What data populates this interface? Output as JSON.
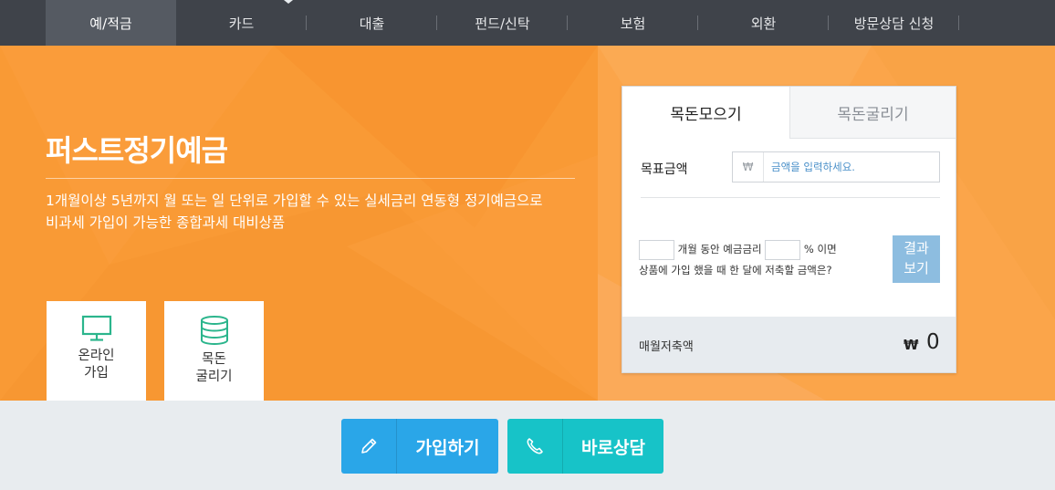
{
  "nav": {
    "items": [
      {
        "label": "예/적금",
        "active": true
      },
      {
        "label": "카드",
        "active": false
      },
      {
        "label": "대출",
        "active": false
      },
      {
        "label": "펀드/신탁",
        "active": false
      },
      {
        "label": "보험",
        "active": false
      },
      {
        "label": "외환",
        "active": false
      },
      {
        "label": "방문상담 신청",
        "active": false
      }
    ]
  },
  "hero": {
    "title": "퍼스트정기예금",
    "description_line1": "1개월이상 5년까지 월 또는 일 단위로 가입할 수 있는 실세금리 연동형 정기예금으로",
    "description_line2": "비과세 가입이 가능한 종합과세 대비상품",
    "tiles": [
      {
        "label": "온라인\n가입",
        "icon": "monitor-icon"
      },
      {
        "label": "목돈\n굴리기",
        "icon": "database-icon"
      }
    ]
  },
  "calculator": {
    "tab_active": "목돈모으기",
    "tab_inactive": "목돈굴리기",
    "amount_label": "목표금액",
    "currency_symbol": "₩",
    "amount_placeholder": "금액을 입력하세요.",
    "amount_value": "",
    "months_value": "",
    "rate_value": "",
    "sentence_part1": "개월 동안 예금금리",
    "sentence_part2": "% 이면",
    "sentence_part3": "상품에 가입 했을 때 한 달에 저축할 금액은?",
    "result_button": "결과\n보기",
    "monthly_label": "매월저축액",
    "monthly_currency": "₩",
    "monthly_value": "0"
  },
  "actions": {
    "join_label": "가입하기",
    "consult_label": "바로상담"
  },
  "colors": {
    "nav_bg": "#3f434a",
    "hero_orange": "#f99a35",
    "join_blue": "#2aa6e8",
    "consult_teal": "#17c3c8",
    "tile_icon_green": "#2bb58c"
  }
}
